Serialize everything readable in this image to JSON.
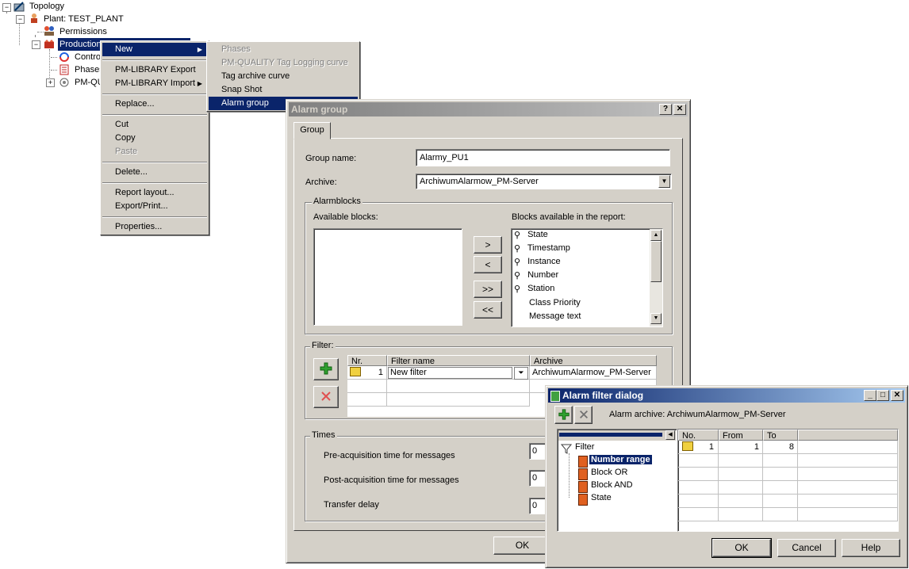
{
  "tree": {
    "root": "Topology",
    "plant": "Plant: TEST_PLANT",
    "permissions": "Permissions",
    "production": "Production",
    "control": "Contro",
    "phases": "Phases",
    "pmq": "PM-QU"
  },
  "context_menu": {
    "items": [
      "New",
      "PM-LIBRARY Export",
      "PM-LIBRARY Import",
      "Replace...",
      "Cut",
      "Copy",
      "Paste",
      "Delete...",
      "Report layout...",
      "Export/Print...",
      "Properties..."
    ]
  },
  "submenu": {
    "items": [
      "Phases",
      "PM-QUALITY Tag Logging curve",
      "Tag archive curve",
      "Snap Shot",
      "Alarm group"
    ]
  },
  "alarm_group_dialog": {
    "title": "Alarm group",
    "help_btn": "?",
    "close_btn": "✕",
    "tab": "Group",
    "group_name_label": "Group name:",
    "group_name_value": "Alarmy_PU1",
    "archive_label": "Archive:",
    "archive_value": "ArchiwumAlarmow_PM-Server",
    "alarmblocks_label": "Alarmblocks",
    "available_label": "Available blocks:",
    "report_label": "Blocks available in the report:",
    "move_right": ">",
    "move_left": "<",
    "move_all_right": ">>",
    "move_all_left": "<<",
    "report_blocks": [
      "State",
      "Timestamp",
      "Instance",
      "Number",
      "Station",
      "Class Priority",
      "Message text"
    ],
    "filter_label": "Filter:",
    "filter_cols": [
      "Nr.",
      "Filter name",
      "Archive"
    ],
    "filter_rows": [
      {
        "nr": "1",
        "name": "New filter",
        "archive": "ArchiwumAlarmow_PM-Server"
      }
    ],
    "times_label": "Times",
    "pre_acq_label": "Pre-acquisition time for messages",
    "post_acq_label": "Post-acquisition time for messages",
    "transfer_label": "Transfer delay",
    "pre_acq_value": "0",
    "post_acq_value": "0",
    "transfer_value": "0",
    "ok": "OK"
  },
  "alarm_filter_dialog": {
    "title": "Alarm filter dialog",
    "archive_text": "Alarm archive: ArchiwumAlarmow_PM-Server",
    "tree_root": "Filter",
    "tree_items": [
      "Number range",
      "Block OR",
      "Block AND",
      "State"
    ],
    "cols": [
      "No.",
      "From",
      "To"
    ],
    "rows": [
      {
        "no": "1",
        "from": "1",
        "to": "8"
      }
    ],
    "ok": "OK",
    "cancel": "Cancel",
    "help": "Help"
  },
  "colors": {
    "selection": "#0a246a",
    "face": "#d4d0c8",
    "active_title": "#0a246a",
    "inactive_title": "#808080"
  }
}
